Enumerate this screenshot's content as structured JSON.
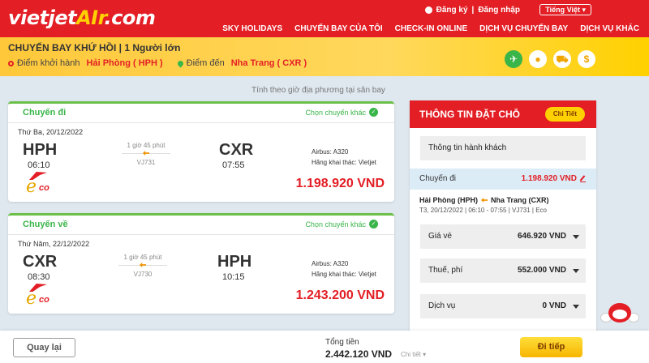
{
  "header": {
    "logo_main": "vietjet",
    "logo_air": "AIr",
    "logo_tld": ".com",
    "register": "Đăng ký",
    "separator": "|",
    "login": "Đăng nhập",
    "language": "Tiếng Việt",
    "nav": [
      "SKY HOLIDAYS",
      "CHUYẾN BAY CỦA TÔI",
      "CHECK-IN ONLINE",
      "DỊCH VỤ CHUYẾN BAY",
      "DỊCH VỤ KHÁC"
    ]
  },
  "trip": {
    "title": "CHUYẾN BAY KHỨ HỒI | 1 Người lớn",
    "origin_label": "Điểm khởi hành",
    "origin_city": "Hải Phòng ( HPH )",
    "dest_label": "Điểm đến",
    "dest_city": "Nha Trang ( CXR )",
    "step_icons": [
      "plane-icon",
      "user-icon",
      "cart-icon",
      "dollar-icon"
    ]
  },
  "note": "Tính theo giờ địa phương tại sân bay",
  "flights": [
    {
      "label": "Chuyến đi",
      "change": "Chọn chuyến khác",
      "date": "Thứ Ba, 20/12/2022",
      "from_code": "HPH",
      "from_time": "06:10",
      "to_code": "CXR",
      "to_time": "07:55",
      "duration": "1 giờ 45 phút",
      "flight_no": "VJ731",
      "aircraft": "Airbus: A320",
      "operator": "Hãng khai thác: Vietjet",
      "price": "1.198.920 VND",
      "fare_brand_e": "e",
      "fare_brand_co": "co"
    },
    {
      "label": "Chuyến về",
      "change": "Chọn chuyến khác",
      "date": "Thứ Năm, 22/12/2022",
      "from_code": "CXR",
      "from_time": "08:30",
      "to_code": "HPH",
      "to_time": "10:15",
      "duration": "1 giờ 45 phút",
      "flight_no": "VJ730",
      "aircraft": "Airbus: A320",
      "operator": "Hãng khai thác: Vietjet",
      "price": "1.243.200 VND",
      "fare_brand_e": "e",
      "fare_brand_co": "co"
    }
  ],
  "booking": {
    "title": "THÔNG TIN ĐẶT CHỖ",
    "detail_button": "Chi Tiết",
    "passenger_info": "Thông tin hành khách",
    "leg_label": "Chuyến đi",
    "leg_price": "1.198.920 VND",
    "route_from": "Hải Phòng (HPH)",
    "route_to": "Nha Trang (CXR)",
    "route_sub": "T3, 20/12/2022 | 06:10 - 07:55 | VJ731 | Eco",
    "fares": [
      {
        "label": "Giá vé",
        "value": "646.920 VND"
      },
      {
        "label": "Thuế, phí",
        "value": "552.000 VND"
      },
      {
        "label": "Dịch vụ",
        "value": "0 VND"
      }
    ]
  },
  "footer": {
    "back": "Quay lại",
    "total_label": "Tổng tiền",
    "total_value": "2.442.120 VND",
    "detail": "Chi tiết",
    "next": "Đi tiếp"
  }
}
